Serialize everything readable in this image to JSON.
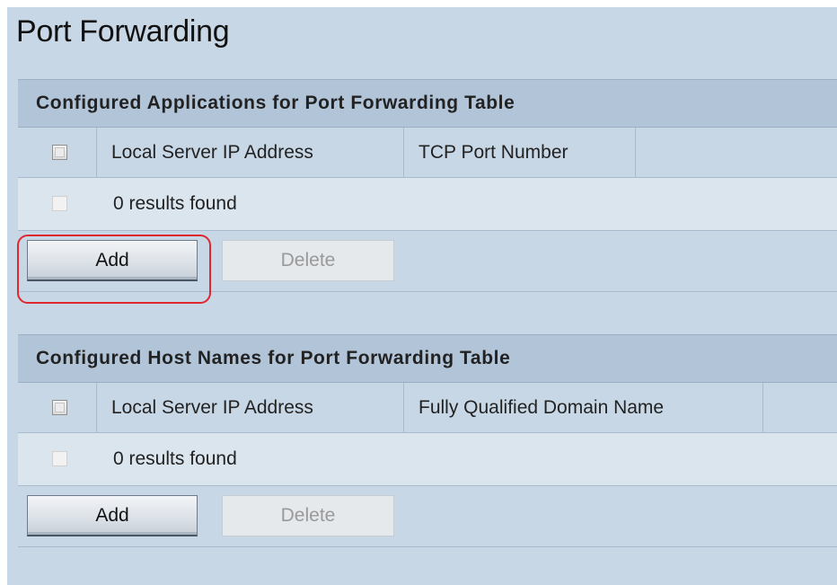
{
  "page": {
    "title": "Port Forwarding"
  },
  "applications_table": {
    "title": "Configured Applications for Port Forwarding Table",
    "columns": [
      "Local Server IP Address",
      "TCP Port Number"
    ],
    "empty_message": "0 results found",
    "add_label": "Add",
    "delete_label": "Delete"
  },
  "hostnames_table": {
    "title": "Configured Host Names for Port Forwarding Table",
    "columns": [
      "Local Server IP Address",
      "Fully Qualified Domain Name"
    ],
    "empty_message": "0 results found",
    "add_label": "Add",
    "delete_label": "Delete"
  },
  "colors": {
    "page_background": "#c8d7e6",
    "header_background": "#b2c4d8",
    "highlight_ring": "#e0262f"
  }
}
